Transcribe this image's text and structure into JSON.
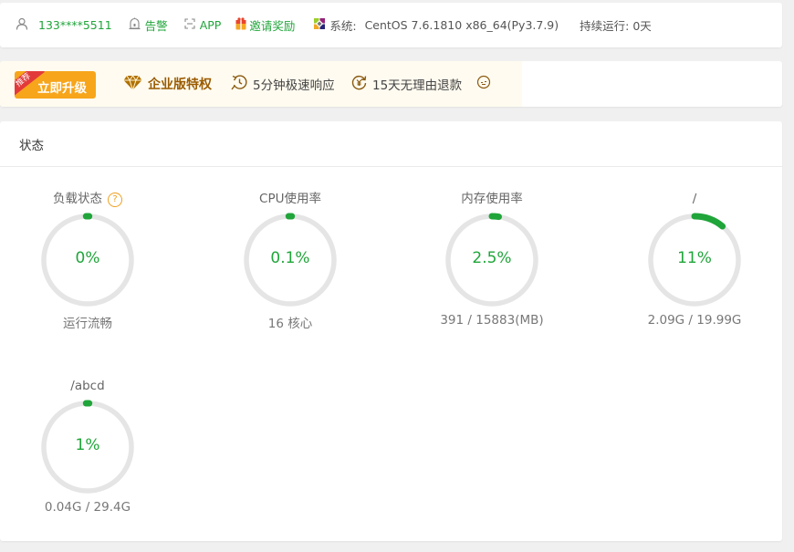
{
  "topbar": {
    "user": "133****5511",
    "alarm": "告警",
    "app": "APP",
    "invite": "邀请奖励",
    "system_label": "系统:",
    "system_value": "CentOS 7.6.1810 x86_64(Py3.7.9)",
    "uptime": "持续运行: 0天"
  },
  "promo": {
    "badge": "推荐",
    "upgrade": "立即升级",
    "enterprise": "企业版特权",
    "fast": "5分钟极速响应",
    "refund": "15天无理由退款"
  },
  "status": {
    "title": "状态",
    "gauges": [
      {
        "title": "负载状态",
        "value": "0%",
        "percent": 0,
        "sub": "运行流畅",
        "help": "?"
      },
      {
        "title": "CPU使用率",
        "value": "0.1%",
        "percent": 0.1,
        "sub": "16 核心"
      },
      {
        "title": "内存使用率",
        "value": "2.5%",
        "percent": 2.5,
        "sub": "391 / 15883(MB)"
      },
      {
        "title": "/",
        "value": "11%",
        "percent": 11,
        "sub": "2.09G / 19.99G"
      },
      {
        "title": "/abcd",
        "value": "1%",
        "percent": 1,
        "sub": "0.04G / 29.4G"
      }
    ]
  },
  "colors": {
    "accent": "#20a53a",
    "track": "#e5e5e5",
    "upgrade": "#f7a51b",
    "ribbon": "#e23a3a"
  }
}
